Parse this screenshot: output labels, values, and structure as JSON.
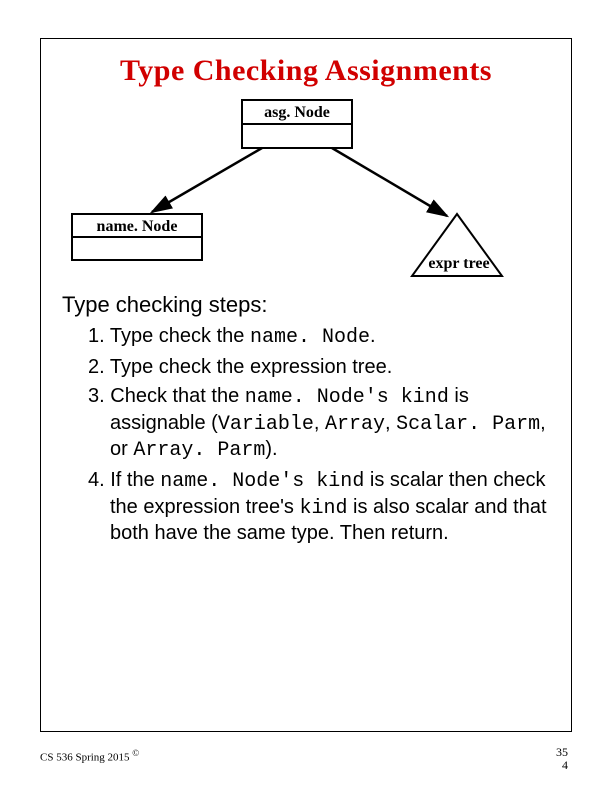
{
  "title": "Type Checking Assignments",
  "diagram": {
    "root_label": "asg. Node",
    "left_label": "name. Node",
    "right_label": "expr tree"
  },
  "steps_heading": "Type checking steps:",
  "steps": [
    {
      "pre": "Type check the ",
      "code1": "name. Node",
      "post1": "."
    },
    {
      "pre": "Type check the expression tree."
    },
    {
      "pre": "Check that the ",
      "code1": "name. Node's kind",
      "mid1": " is assignable (",
      "code2": "Variable",
      "mid2": ", ",
      "code3": "Array",
      "mid3": ", ",
      "code4": "Scalar. Parm",
      "mid4": ", or ",
      "code5": "Array. Parm",
      "post1": ")."
    },
    {
      "pre": "If the ",
      "code1": "name. Node's kind",
      "mid1": " is scalar then check the expression tree's ",
      "code2": "kind",
      "post1": " is also scalar and that both have the same type. Then return."
    }
  ],
  "footer": {
    "left": "CS 536  Spring 2015",
    "copyright": "©",
    "page_a": "35",
    "page_b": "4"
  }
}
